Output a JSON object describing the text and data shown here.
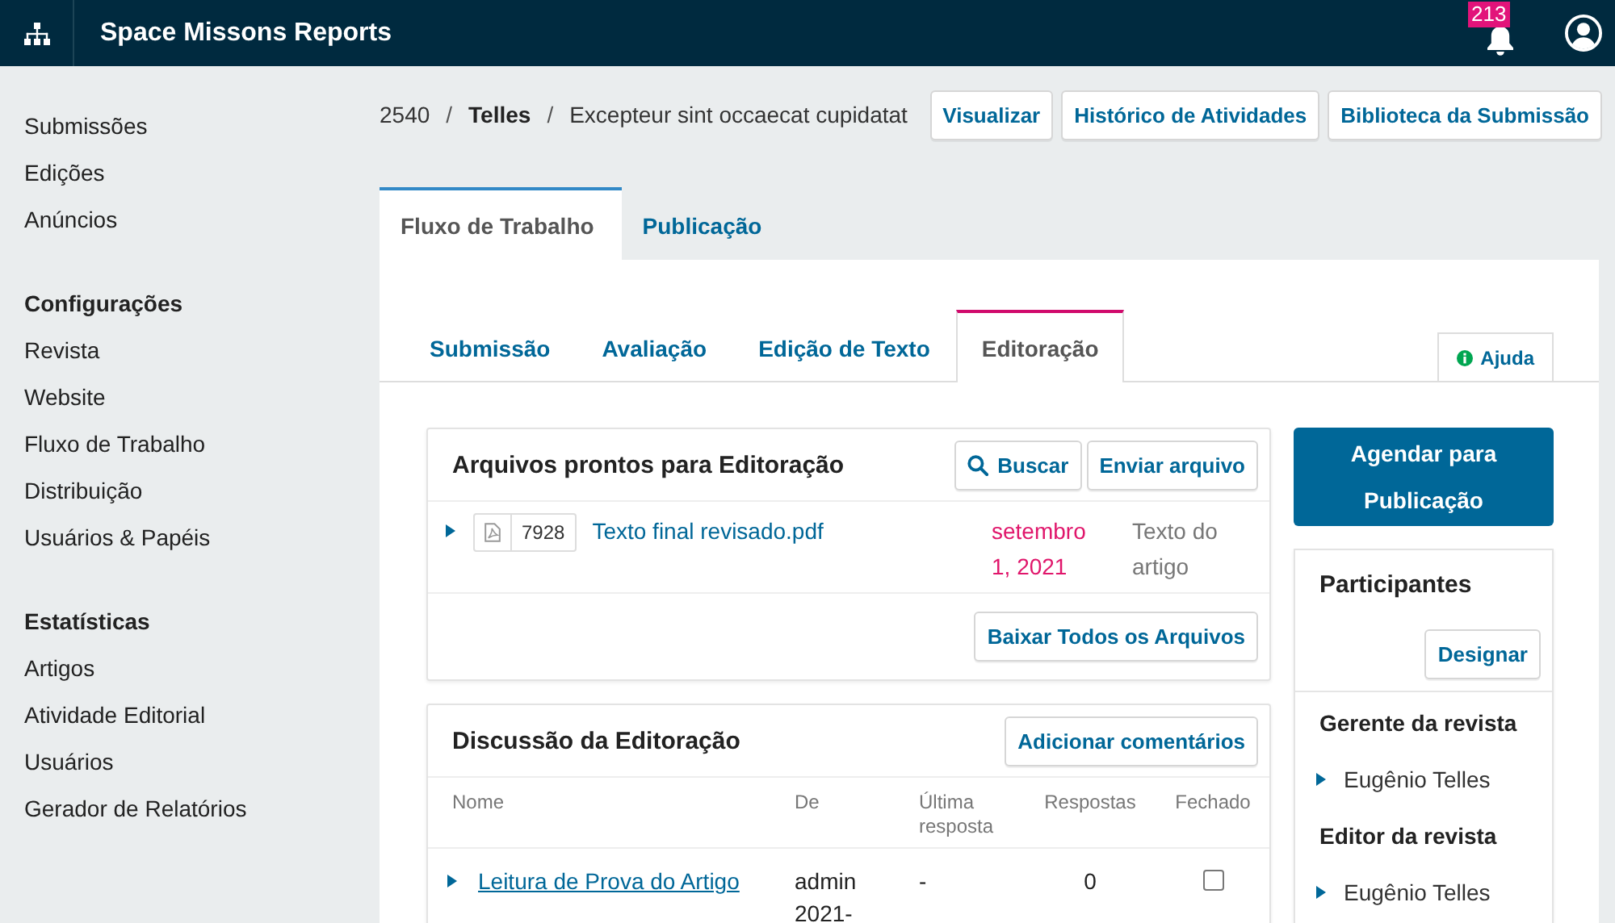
{
  "app_bar": {
    "title": "Space Missons Reports",
    "notifications": {
      "count": "213"
    }
  },
  "sidebar": {
    "sections": [
      {
        "items": [
          "Submissões",
          "Edições",
          "Anúncios"
        ]
      },
      {
        "heading": "Configurações",
        "items": [
          "Revista",
          "Website",
          "Fluxo de Trabalho",
          "Distribuição",
          "Usuários & Papéis"
        ]
      },
      {
        "heading": "Estatísticas",
        "items": [
          "Artigos",
          "Atividade Editorial",
          "Usuários",
          "Gerador de Relatórios"
        ]
      }
    ]
  },
  "breadcrumb": [
    {
      "text": "2540",
      "kind": "plain"
    },
    {
      "text": "/",
      "kind": "separator"
    },
    {
      "text": "Telles",
      "kind": "bold"
    },
    {
      "text": "/",
      "kind": "separator"
    },
    {
      "text": "Excepteur sint occaecat cupidatat",
      "kind": "plain"
    }
  ],
  "actions": [
    "Visualizar",
    "Histórico de Atividades",
    "Biblioteca da Submissão"
  ],
  "tabs": [
    {
      "label": "Fluxo de Trabalho",
      "selected": true
    },
    {
      "label": "Publicação",
      "selected": false
    }
  ],
  "stage_tabs": [
    {
      "label": "Submissão",
      "selected": false
    },
    {
      "label": "Avaliação",
      "selected": false
    },
    {
      "label": "Edição de Texto",
      "selected": false
    },
    {
      "label": "Editoração",
      "selected": true
    }
  ],
  "help_tab": {
    "label": "Ajuda"
  },
  "files_panel": {
    "title": "Arquivos prontos para Editoração",
    "buttons": [
      {
        "label": "Buscar",
        "kind": "search"
      },
      {
        "label": "Enviar arquivo",
        "kind": "plain"
      }
    ],
    "files": [
      {
        "id": "7928",
        "name": "Texto final revisado.pdf",
        "date": "setembro 1, 2021",
        "type": "Texto do artigo",
        "expanded": false
      }
    ],
    "footer_button": "Baixar Todos os Arquivos"
  },
  "discussion_panel": {
    "title": "Discussão da Editoração",
    "button": "Adicionar comentários",
    "columns": [
      "Nome",
      "De",
      "Última resposta",
      "Respostas",
      "Fechado"
    ],
    "rows": [
      {
        "name": "Leitura de Prova do Artigo",
        "from": "admin 2021-",
        "last_reply": "-",
        "replies": "0",
        "closed": false,
        "expanded": false
      }
    ]
  },
  "schedule_button": "Agendar para Publicação",
  "participants": {
    "title": "Participantes",
    "button": "Designar",
    "groups": [
      {
        "role": "Gerente da revista",
        "members": [
          {
            "name": "Eugênio Telles",
            "expanded": false
          }
        ]
      },
      {
        "role": "Editor da revista",
        "members": [
          {
            "name": "Eugênio Telles",
            "expanded": false
          }
        ]
      }
    ]
  }
}
